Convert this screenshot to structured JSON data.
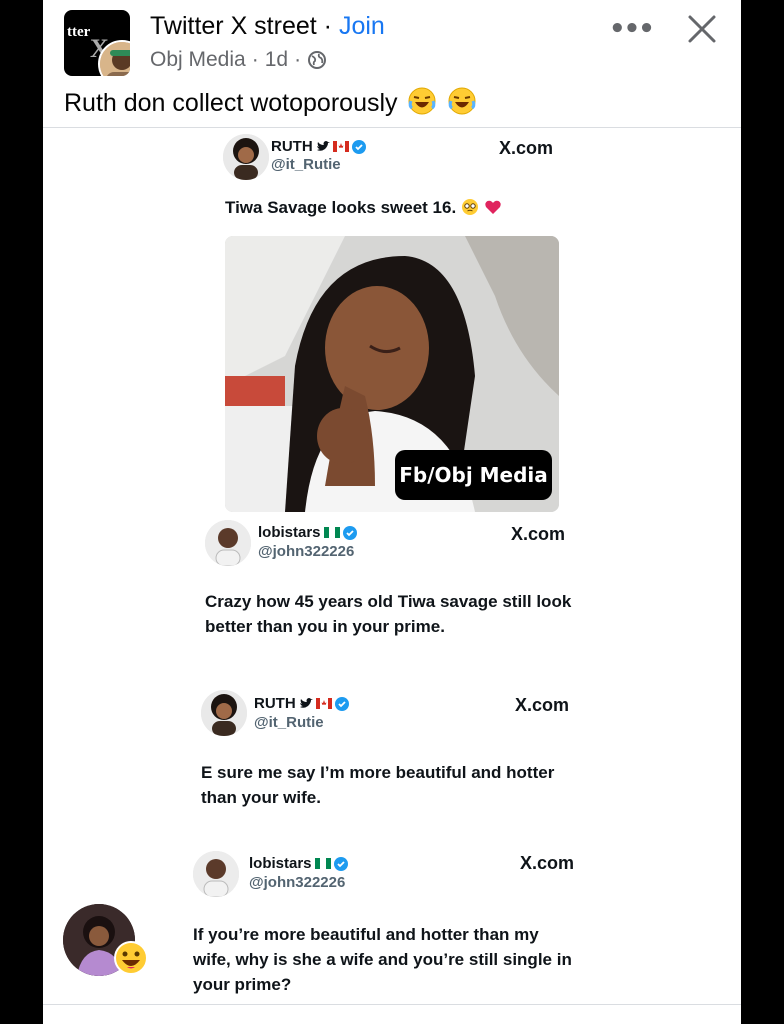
{
  "header": {
    "page_logo_text": "tter",
    "group_name": "Twitter X street",
    "separator": " · ",
    "join_label": "Join",
    "author": "Obj Media",
    "time": "1d",
    "dot": "·"
  },
  "caption": {
    "text": "Ruth don collect wotoporously"
  },
  "tweets": [
    {
      "name": "RUTH",
      "handle": "@it_Rutie",
      "source": "X.com",
      "text": "Tiwa Savage looks sweet 16."
    },
    {
      "name": "lobistars",
      "handle": "@john322226",
      "source": "X.com",
      "text": "Crazy how 45 years old Tiwa savage still look better than you in your prime."
    },
    {
      "name": "RUTH",
      "handle": "@it_Rutie",
      "source": "X.com",
      "text": "E sure me say I’m more beautiful and hotter than your wife."
    },
    {
      "name": "lobistars",
      "handle": "@john322226",
      "source": "X.com",
      "text": "If you’re more beautiful and hotter than my wife, why is she a wife and you’re still single in your prime?"
    }
  ],
  "image": {
    "watermark": "Fb/Obj Media"
  },
  "colors": {
    "link": "#1877f2",
    "verified": "#1d9bf0",
    "muted": "#65676b"
  },
  "icons": [
    "more-options-icon",
    "close-icon",
    "globe-icon",
    "laughing-emoji-icon",
    "verified-badge-icon",
    "x-logo-icon",
    "canada-flag-icon",
    "nigeria-flag-icon",
    "grinning-emoji-icon"
  ]
}
